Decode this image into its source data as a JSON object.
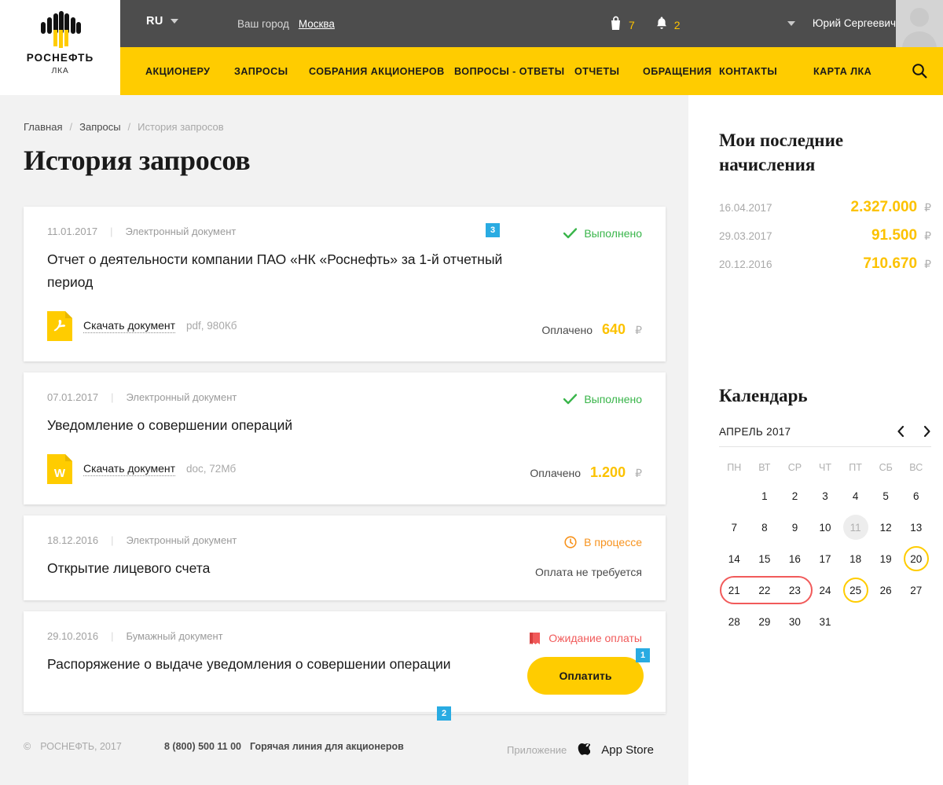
{
  "brand": {
    "name": "РОСНЕФТЬ",
    "sub": "ЛКА",
    "logo_icon": "rosneft-logo-icon"
  },
  "topbar": {
    "language": "RU",
    "city_label": "Ваш город",
    "city_value": "Москва",
    "cart_icon": "cart-icon",
    "cart_count": "7",
    "bell_icon": "bell-icon",
    "bell_count": "2",
    "user_name": "Юрий Сергеевич",
    "avatar_icon": "avatar-icon",
    "caret_icon": "chevron-down-icon"
  },
  "nav": {
    "items": [
      {
        "label": "АКЦИОНЕРУ"
      },
      {
        "label": "ЗАПРОСЫ"
      },
      {
        "label": "СОБРАНИЯ АКЦИОНЕРОВ"
      },
      {
        "label": "ВОПРОСЫ - ОТВЕТЫ"
      },
      {
        "label": "ОТЧЕТЫ"
      },
      {
        "label": "ОБРАЩЕНИЯ"
      },
      {
        "label": "КОНТАКТЫ"
      },
      {
        "label": "КАРТА ЛКА"
      }
    ],
    "search_icon": "search-icon"
  },
  "breadcrumb": {
    "home": "Главная",
    "section": "Запросы",
    "current": "История запросов",
    "separator": "/"
  },
  "page": {
    "title": "История запросов",
    "print_icon": "printer-icon"
  },
  "annotations": [
    {
      "id": "ann-3",
      "number": "3"
    },
    {
      "id": "ann-1",
      "number": "1"
    },
    {
      "id": "ann-2",
      "number": "2"
    }
  ],
  "requests": [
    {
      "date": "11.01.2017",
      "type": "Электронный документ",
      "title": "Отчет о деятельности компании ПАО «НК «Роснефть» за 1-й отчетный период",
      "status": "Выполнено",
      "status_kind": "done",
      "status_icon": "check-icon",
      "file_icon": "pdf-file-icon",
      "download_label": "Скачать документ",
      "file_meta": "pdf, 980Кб",
      "pay_label": "Оплачено",
      "pay_sum": "640",
      "currency": "₽"
    },
    {
      "date": "07.01.2017",
      "type": "Электронный документ",
      "title": "Уведомление о совершении операций",
      "status": "Выполнено",
      "status_kind": "done",
      "status_icon": "check-icon",
      "file_icon": "word-file-icon",
      "download_label": "Скачать документ",
      "file_meta": "doc, 72Мб",
      "pay_label": "Оплачено",
      "pay_sum": "1.200",
      "currency": "₽"
    },
    {
      "date": "18.12.2016",
      "type": "Электронный документ",
      "title": "Открытие лицевого счета",
      "status": "В процессе",
      "status_kind": "progress",
      "status_icon": "clock-icon",
      "no_pay_label": "Оплата не требуется"
    },
    {
      "date": "29.10.2016",
      "type": "Бумажный документ",
      "title": "Распоряжение о выдаче уведомления о совершении операции",
      "status": "Ожидание оплаты",
      "status_kind": "waiting",
      "status_icon": "invoice-icon",
      "pay_button": "Оплатить"
    }
  ],
  "accruals": {
    "heading": "Мои последние начисления",
    "currency": "₽",
    "rows": [
      {
        "date": "16.04.2017",
        "amount": "2.327.000"
      },
      {
        "date": "29.03.2017",
        "amount": "91.500"
      },
      {
        "date": "20.12.2016",
        "amount": "710.670"
      }
    ]
  },
  "calendar": {
    "heading": "Календарь",
    "month": "АПРЕЛЬ 2017",
    "prev_icon": "chevron-left-icon",
    "next_icon": "chevron-right-icon",
    "dow": [
      "ПН",
      "ВТ",
      "СР",
      "ЧТ",
      "ПТ",
      "СБ",
      "ВС"
    ],
    "weeks": [
      [
        null,
        "1",
        "2",
        "3",
        "4",
        "5",
        "6"
      ],
      [
        "7",
        "8",
        "9",
        "10",
        "11",
        "12",
        "13"
      ],
      [
        "14",
        "15",
        "16",
        "17",
        "18",
        "19",
        "20"
      ],
      [
        "21",
        "22",
        "23",
        "24",
        "25",
        "26",
        "27"
      ],
      [
        "28",
        "29",
        "30",
        "31",
        null,
        null,
        null
      ]
    ],
    "today": "11",
    "marked": [
      "20",
      "25"
    ],
    "range": [
      "21",
      "22",
      "23"
    ]
  },
  "footer": {
    "copyright_symbol": "©",
    "copyright": "РОСНЕФТЬ, 2017",
    "phone": "8 (800) 500 11 00",
    "phone_note": "Горячая линия для акционеров",
    "app_label": "Приложение",
    "store": "App Store",
    "apple_icon": "apple-icon"
  },
  "colors": {
    "brand_yellow": "#ffcc00",
    "topbar_gray": "#4d4d4d",
    "accent_blue": "#29abe2",
    "status_green": "#39b54a",
    "status_orange": "#f7931e",
    "status_red": "#f15a5a"
  }
}
